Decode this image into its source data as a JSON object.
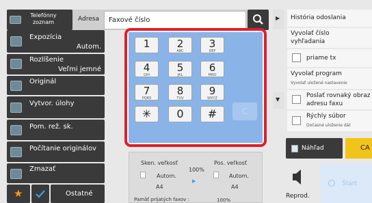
{
  "topbar": {
    "phonebook_label": "Telefónny zoznam",
    "address_label": "Adresa",
    "address_placeholder": "Faxové číslo"
  },
  "left_menu": {
    "exposure_label": "Expozícia",
    "exposure_value": "Autom.",
    "resolution_label": "Rozlíšenie",
    "resolution_value": "Veľmi jemné",
    "original_label": "Originál",
    "create_job_label": "Vytvor. úlohy",
    "special_mode_label": "Pom. rež. sk.",
    "count_originals_label": "Počítanie originálov",
    "erase_label": "Zmazať",
    "others_label": "Ostatné"
  },
  "keypad": {
    "keys": [
      {
        "digit": "1",
        "letters": ""
      },
      {
        "digit": "2",
        "letters": "ABC"
      },
      {
        "digit": "3",
        "letters": "DEF"
      },
      {
        "digit": "4",
        "letters": "GHI"
      },
      {
        "digit": "5",
        "letters": "JKL"
      },
      {
        "digit": "6",
        "letters": "MNO"
      },
      {
        "digit": "7",
        "letters": "PQRS"
      },
      {
        "digit": "8",
        "letters": "TUV"
      },
      {
        "digit": "9",
        "letters": "WXYZ"
      },
      {
        "digit": "✳",
        "letters": ""
      },
      {
        "digit": "0",
        "letters": ""
      },
      {
        "digit": "#",
        "letters": ""
      }
    ],
    "c_label": "C"
  },
  "scan_info": {
    "scan_size_label": "Sken. veľkosť",
    "scan_size_value": "Autom.",
    "scan_paper": "A4",
    "ratio": "100%",
    "send_size_label": "Pos. veľkosť",
    "send_size_value": "Autom.",
    "send_paper": "A4",
    "memory_label": "Pamäť prijatých faxov :",
    "memory_value": "100%"
  },
  "right_panel": {
    "history_label": "História odoslania",
    "recall_number_label": "Vyvolať číslo vyhľadania",
    "direct_tx_label": "priame tx",
    "recall_program_label": "Vyvolať program",
    "recall_program_sub": "Vyvolať uložené nastavenie",
    "same_image_label": "Poslať rovnaký obraz ako adresu faxu",
    "quick_file_label": "Rýchly súbor",
    "quick_file_sub": "Dočasné uloženie dát",
    "preview_label": "Náhľad",
    "ca_label": "CA",
    "playback_label": "Reprod.",
    "start_label": "Štart"
  },
  "colors": {
    "accent_red": "#e01e2d",
    "keypad_blue": "#8ab4e8",
    "ca_yellow": "#f1c419",
    "dark_button": "#3a3a3a"
  }
}
